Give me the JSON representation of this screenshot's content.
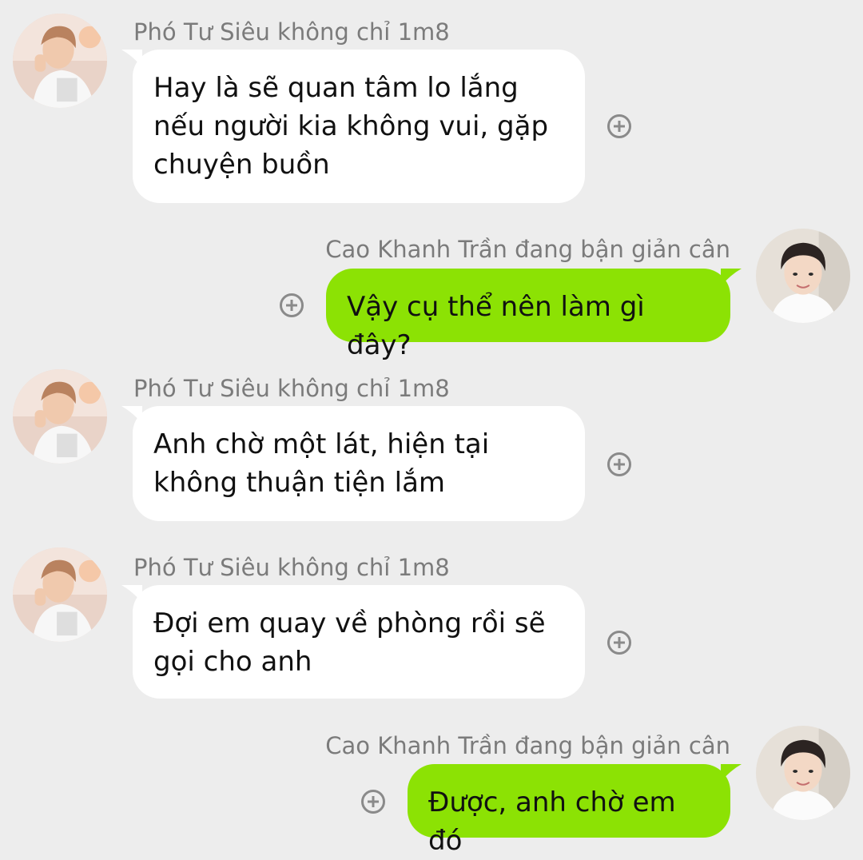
{
  "colors": {
    "background": "#ededed",
    "incoming_bubble": "#ffffff",
    "outgoing_bubble": "#8ce204",
    "name_text": "#7b7b7b"
  },
  "messages": [
    {
      "direction": "incoming",
      "sender": "Phó Tư Siêu không chỉ 1m8",
      "avatar": "avatar-photo-icon",
      "text": "Hay là sẽ quan tâm lo lắng nếu người kia không vui, gặp chuyện buồn"
    },
    {
      "direction": "outgoing",
      "sender": "Cao Khanh Trần đang bận giản cân",
      "avatar": "avatar-photo-icon",
      "text": "Vậy cụ thể nên làm gì đây?"
    },
    {
      "direction": "incoming",
      "sender": "Phó Tư Siêu không chỉ 1m8",
      "avatar": "avatar-photo-icon",
      "text": "Anh chờ một lát, hiện tại không thuận tiện lắm"
    },
    {
      "direction": "incoming",
      "sender": "Phó Tư Siêu không chỉ 1m8",
      "avatar": "avatar-photo-icon",
      "text": "Đợi em quay về phòng rồi sẽ gọi cho anh"
    },
    {
      "direction": "outgoing",
      "sender": "Cao Khanh Trần đang bận giản cân",
      "avatar": "avatar-photo-icon",
      "text": "Được, anh chờ em đó"
    }
  ]
}
